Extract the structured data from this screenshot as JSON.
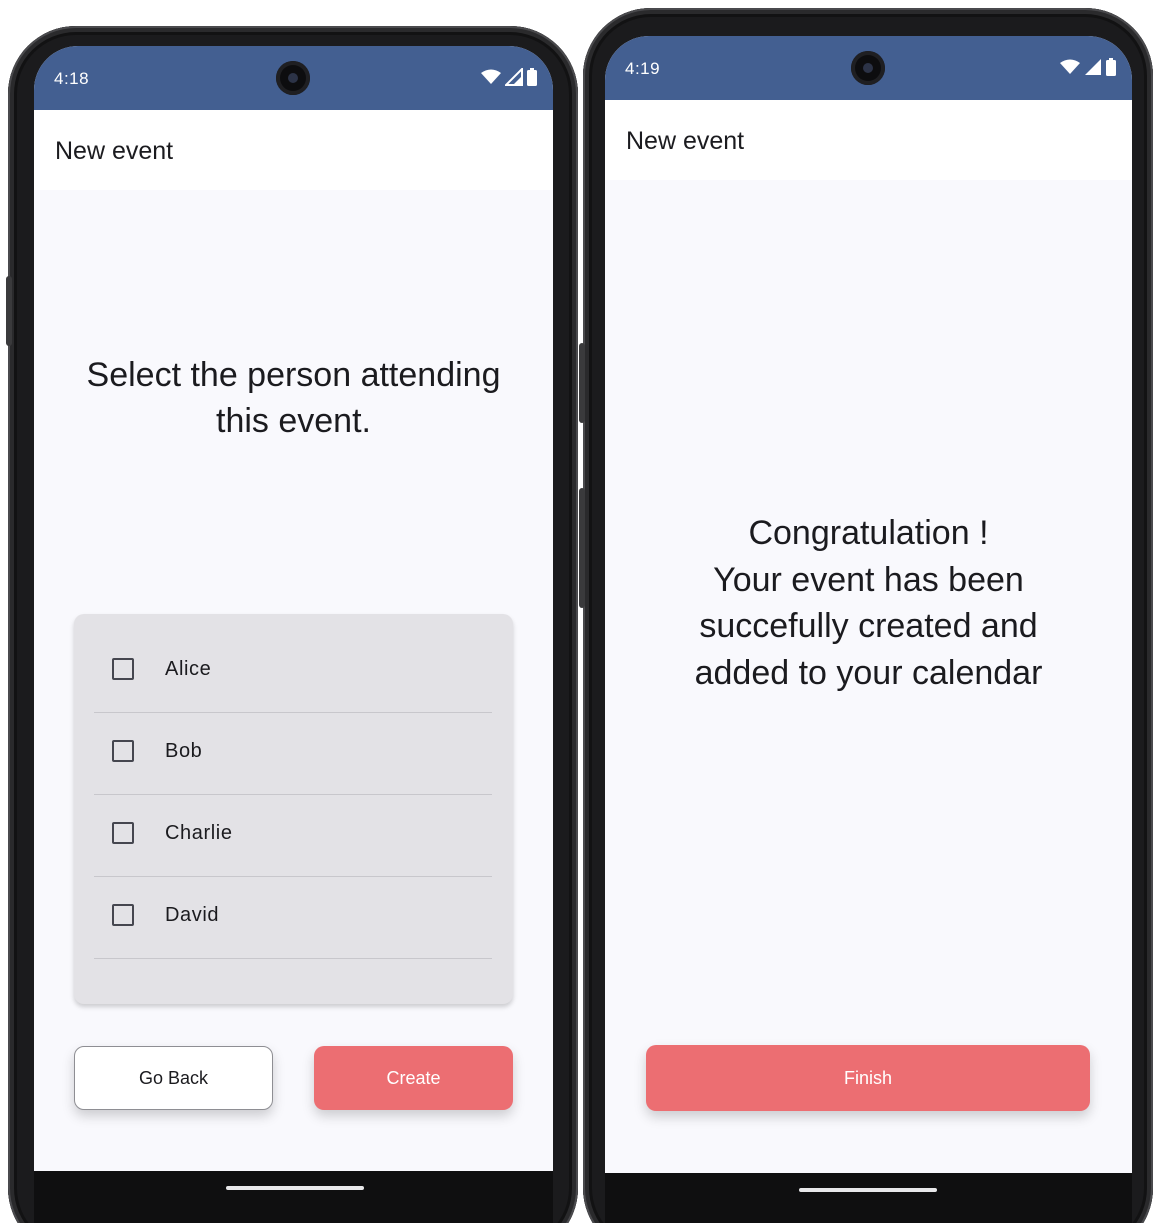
{
  "screens": [
    {
      "status_bar": {
        "time": "4:18"
      },
      "app_bar": {
        "title": "New event"
      },
      "prompt": {
        "line1": "Select the person attending",
        "line2": "this event."
      },
      "people": [
        {
          "name": "Alice",
          "checked": false
        },
        {
          "name": "Bob",
          "checked": false
        },
        {
          "name": "Charlie",
          "checked": false
        },
        {
          "name": "David",
          "checked": false
        }
      ],
      "buttons": {
        "back_label": "Go Back",
        "create_label": "Create"
      }
    },
    {
      "status_bar": {
        "time": "4:19"
      },
      "app_bar": {
        "title": "New event"
      },
      "message": {
        "line1": "Congratulation !",
        "line2": "Your event has been",
        "line3": "succefully created and",
        "line4": "added to your calendar"
      },
      "buttons": {
        "finish_label": "Finish"
      }
    }
  ],
  "icons": {
    "status": [
      "wifi-icon",
      "cellular-signal-icon",
      "battery-icon"
    ],
    "checkbox": "checkbox-unchecked-icon"
  },
  "colors": {
    "status_bar": "#435f91",
    "accent_button": "#ec6e72",
    "list_background": "#e3e2e6",
    "screen_background": "#f9f9fd"
  }
}
